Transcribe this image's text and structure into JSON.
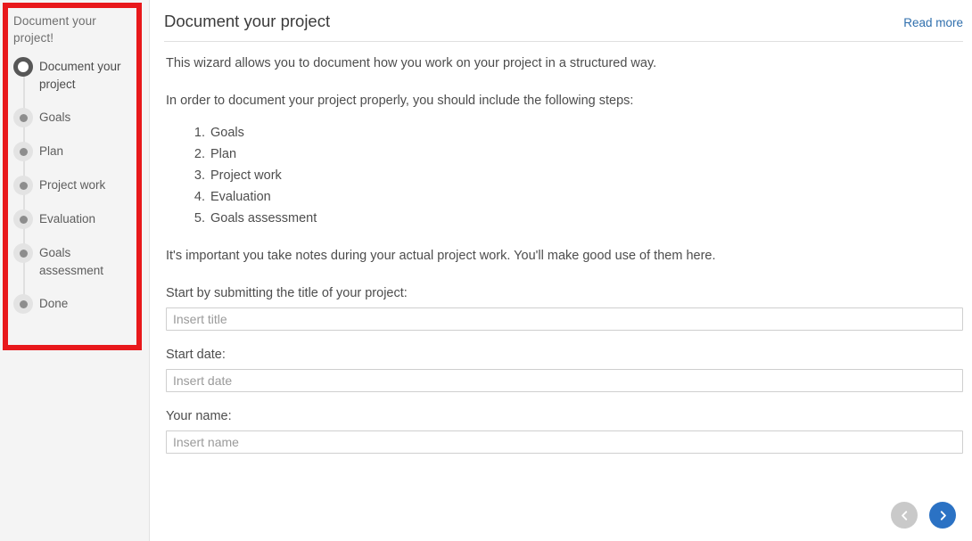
{
  "colors": {
    "highlight_box": "#e8181b",
    "link": "#2f6fad",
    "next_button": "#2b72c4",
    "prev_button": "#c9c9c9",
    "sidebar_bg": "#f4f4f4",
    "active_step": "#575757"
  },
  "sidebar": {
    "title": "Document your project!",
    "steps": [
      {
        "label": "Document your project",
        "state": "active"
      },
      {
        "label": "Goals",
        "state": "inactive"
      },
      {
        "label": "Plan",
        "state": "inactive"
      },
      {
        "label": "Project work",
        "state": "inactive"
      },
      {
        "label": "Evaluation",
        "state": "inactive"
      },
      {
        "label": "Goals assessment",
        "state": "inactive"
      },
      {
        "label": "Done",
        "state": "inactive"
      }
    ]
  },
  "header": {
    "title": "Document your project",
    "read_more_label": "Read more"
  },
  "body": {
    "intro_paragraph": "This wizard allows you to document how you work on your project in a structured way.",
    "steps_lead": "In order to document your project properly, you should include the following steps:",
    "step_list": [
      "Goals",
      "Plan",
      "Project work",
      "Evaluation",
      "Goals assessment"
    ],
    "notes_paragraph": "It's important you take notes during your actual project work. You'll make good use of them here."
  },
  "form": {
    "title_field": {
      "label": "Start by submitting the title of your project:",
      "placeholder": "Insert title",
      "value": ""
    },
    "date_field": {
      "label": "Start date:",
      "placeholder": "Insert date",
      "value": ""
    },
    "name_field": {
      "label": "Your name:",
      "placeholder": "Insert name",
      "value": ""
    }
  },
  "navigation": {
    "prev_icon": "chevron-left-icon",
    "next_icon": "chevron-right-icon"
  }
}
